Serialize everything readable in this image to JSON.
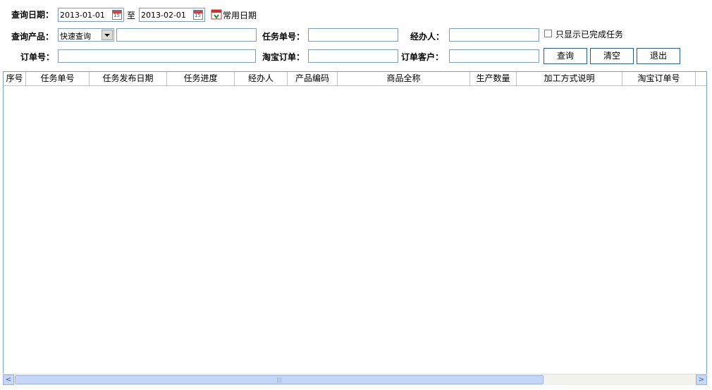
{
  "filters": {
    "query_date_label": "查询日期：",
    "date_from": "2013-01-01",
    "date_sep": "至",
    "date_to": "2013-02-01",
    "common_dates_label": "常用日期",
    "product_label": "查询产品：",
    "product_mode": "快速查询",
    "product_value": "",
    "task_no_label": "任务单号：",
    "task_no_value": "",
    "handler_label": "经办人：",
    "handler_value": "",
    "show_completed_label": "只显示已完成任务",
    "order_no_label": "订单号：",
    "order_no_value": "",
    "taobao_order_label": "淘宝订单：",
    "taobao_order_value": "",
    "order_customer_label": "订单客户：",
    "order_customer_value": "",
    "calendar_icon_text": "15"
  },
  "buttons": {
    "query": "查询",
    "clear": "清空",
    "exit": "退出"
  },
  "grid": {
    "columns": [
      "序号",
      "任务单号",
      "任务发布日期",
      "任务进度",
      "经办人",
      "产品编码",
      "商品全称",
      "生产数量",
      "加工方式说明",
      "淘宝订单号"
    ],
    "rows": []
  },
  "scrollbar": {
    "left_arrow": "<",
    "right_arrow": ">",
    "thumb_grip": "|||"
  },
  "icons": {
    "calendar": "calendar-icon",
    "common_dates": "common-dates-icon",
    "dropdown": "chevron-down-icon"
  }
}
